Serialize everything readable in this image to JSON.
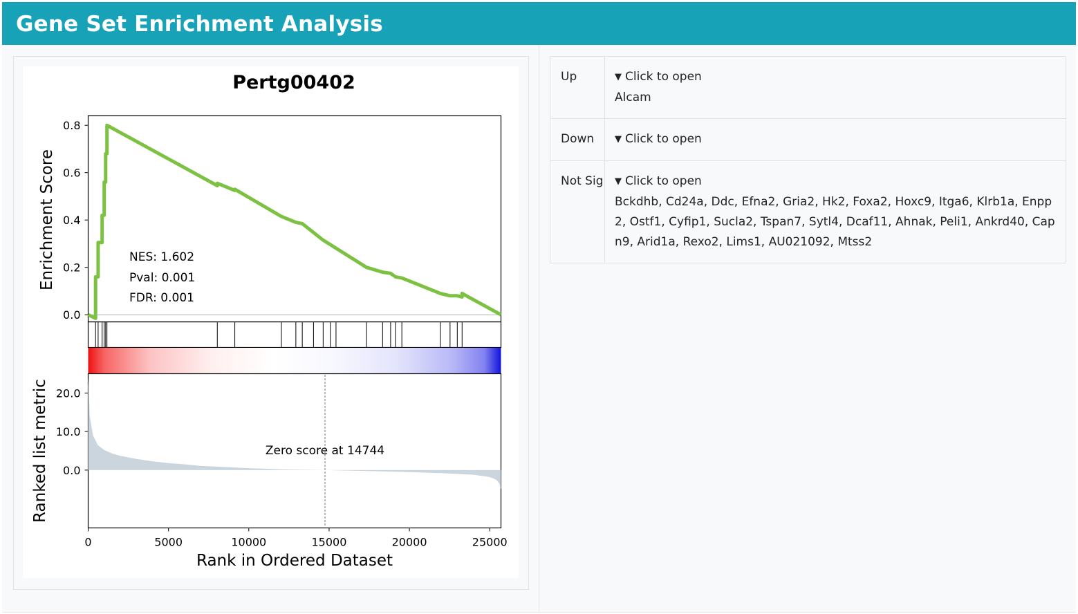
{
  "header": {
    "title": "Gene Set Enrichment Analysis"
  },
  "table": {
    "rows": [
      {
        "label": "Up",
        "toggle": "Click to open",
        "genes": "Alcam"
      },
      {
        "label": "Down",
        "toggle": "Click to open",
        "genes": ""
      },
      {
        "label": "Not Sig",
        "toggle": "Click to open",
        "genes": "Bckdhb, Cd24a, Ddc, Efna2, Gria2, Hk2, Foxa2, Hoxc9, Itga6, Klrb1a, Enpp2, Ostf1, Cyfip1, Sucla2, Tspan7, Sytl4, Dcaf11, Ahnak, Peli1, Ankrd40, Capn9, Arid1a, Rexo2, Lims1, AU021092, Mtss2"
      }
    ]
  },
  "colors": {
    "header": "#17a2b8",
    "curve": "#7dc142",
    "metric_fill": "#cbd5dd"
  },
  "chart_data": {
    "type": "line",
    "title": "Pertg00402",
    "xlabel": "Rank in Ordered Dataset",
    "ylabel_top": "Enrichment Score",
    "ylabel_bottom": "Ranked list metric",
    "xlim": [
      0,
      25700
    ],
    "ylim_top": [
      -0.03,
      0.84
    ],
    "ylim_bottom": [
      -15,
      25
    ],
    "xticks": [
      0,
      5000,
      10000,
      15000,
      20000,
      25000
    ],
    "xtick_labels": [
      "0",
      "5000",
      "10000",
      "15000",
      "20000",
      "25000"
    ],
    "yticks_top": [
      0.0,
      0.2,
      0.4,
      0.6,
      0.8
    ],
    "ytick_labels_top": [
      "0.0",
      "0.2",
      "0.4",
      "0.6",
      "0.8"
    ],
    "yticks_bottom": [
      0.0,
      10.0,
      20.0
    ],
    "ytick_labels_bottom": [
      "0.0",
      "10.0",
      "20.0"
    ],
    "stats": [
      "NES: 1.602",
      "Pval: 0.001",
      "FDR: 0.001"
    ],
    "zero_score_rank": 14744,
    "zero_score_label": "Zero score at 14744",
    "hits": [
      460,
      620,
      870,
      1000,
      1090,
      1170,
      8040,
      9130,
      12030,
      12930,
      13330,
      14030,
      14630,
      15080,
      15430,
      17330,
      18330,
      18830,
      19130,
      19530,
      21930,
      22530,
      22980,
      23280
    ],
    "es_curve": {
      "x": [
        0,
        460,
        460,
        620,
        620,
        870,
        870,
        1000,
        1000,
        1090,
        1090,
        1170,
        1170,
        8040,
        8040,
        9130,
        9130,
        12030,
        12930,
        13330,
        14630,
        17330,
        18330,
        18830,
        19130,
        19530,
        21930,
        22530,
        22980,
        23280,
        23280,
        25700
      ],
      "y": [
        0.0,
        -0.015,
        0.16,
        0.16,
        0.305,
        0.305,
        0.42,
        0.42,
        0.56,
        0.56,
        0.68,
        0.68,
        0.8,
        0.545,
        0.555,
        0.525,
        0.53,
        0.415,
        0.39,
        0.385,
        0.315,
        0.2,
        0.18,
        0.175,
        0.16,
        0.155,
        0.09,
        0.08,
        0.08,
        0.075,
        0.09,
        0.0
      ]
    },
    "metric_curve": {
      "x": [
        0,
        100,
        300,
        600,
        1000,
        1500,
        2000,
        3000,
        4000,
        5000,
        6000,
        7000,
        8000,
        10000,
        12000,
        14744,
        17000,
        20000,
        22000,
        24000,
        25000,
        25400,
        25600,
        25700
      ],
      "y": [
        24,
        14,
        9,
        6.5,
        5.2,
        4.3,
        3.7,
        2.9,
        2.3,
        1.8,
        1.5,
        1.1,
        0.9,
        0.5,
        0.2,
        0.0,
        -0.2,
        -0.5,
        -0.8,
        -1.2,
        -1.8,
        -2.5,
        -3.5,
        -5
      ]
    }
  }
}
